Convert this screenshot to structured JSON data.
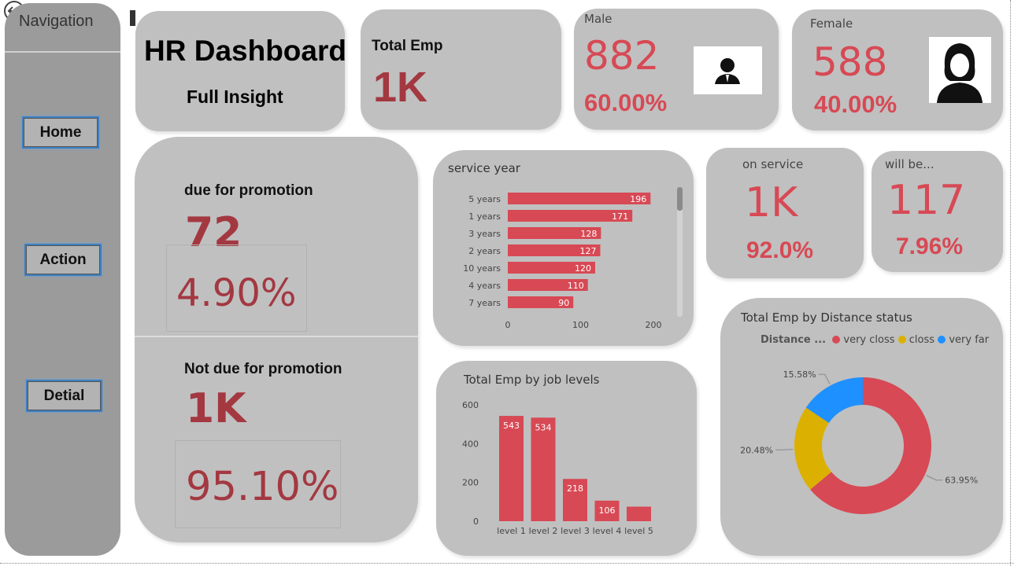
{
  "nav": {
    "title": "Navigation",
    "buttons": [
      "Home",
      "Action",
      "Detial"
    ]
  },
  "header": {
    "title": "HR Dashboard",
    "subtitle": "Full Insight"
  },
  "kpis": {
    "total_emp": {
      "label": "Total Emp",
      "value": "1K"
    },
    "male": {
      "label": "Male",
      "value": "882",
      "pct": "60.00%"
    },
    "female": {
      "label": "Female",
      "value": "588",
      "pct": "40.00%"
    },
    "on_service": {
      "label": "on service",
      "value": "1K",
      "pct": "92.0%"
    },
    "will_be": {
      "label": "will be...",
      "value": "117",
      "pct": "7.96%"
    },
    "due": {
      "label": "due for promotion",
      "value": "72",
      "pct": "4.90%"
    },
    "not_due": {
      "label": "Not due for promotion",
      "value": "1K",
      "pct": "95.10%"
    }
  },
  "colors": {
    "card": "#c0c0c0",
    "nav": "#9b9b9b",
    "red": "#d74954",
    "dark_red": "#a33841",
    "yellow": "#dcb000",
    "blue": "#1e90ff"
  },
  "icons": {
    "male": "male-avatar-icon",
    "female": "female-avatar-icon",
    "back": "back-arrow-icon"
  },
  "chart_data": [
    {
      "type": "bar",
      "orientation": "horizontal",
      "title": "service year",
      "categories": [
        "5 years",
        "1 years",
        "3 years",
        "2 years",
        "10 years",
        "4 years",
        "7 years"
      ],
      "values": [
        196,
        171,
        128,
        127,
        120,
        110,
        90
      ],
      "xlim": [
        0,
        200
      ],
      "xticks": [
        "0",
        "100",
        "200"
      ]
    },
    {
      "type": "bar",
      "title": "Total Emp by job levels",
      "categories": [
        "level 1",
        "level 2",
        "level 3",
        "level 4",
        "level 5"
      ],
      "values": [
        543,
        534,
        218,
        106,
        75
      ],
      "data_labels": [
        "543",
        "534",
        "218",
        "106",
        ""
      ],
      "ylim": [
        0,
        600
      ],
      "yticks": [
        "600",
        "400",
        "200",
        "0"
      ]
    },
    {
      "type": "pie",
      "title": "Total Emp by Distance status",
      "legend_title": "Distance ...",
      "legend_position": "top",
      "slices": [
        {
          "name": "very closs",
          "value": 63.95,
          "label": "63.95%"
        },
        {
          "name": "closs",
          "value": 20.48,
          "label": "20.48%"
        },
        {
          "name": "very far",
          "value": 15.58,
          "label": "15.58%"
        }
      ]
    }
  ]
}
